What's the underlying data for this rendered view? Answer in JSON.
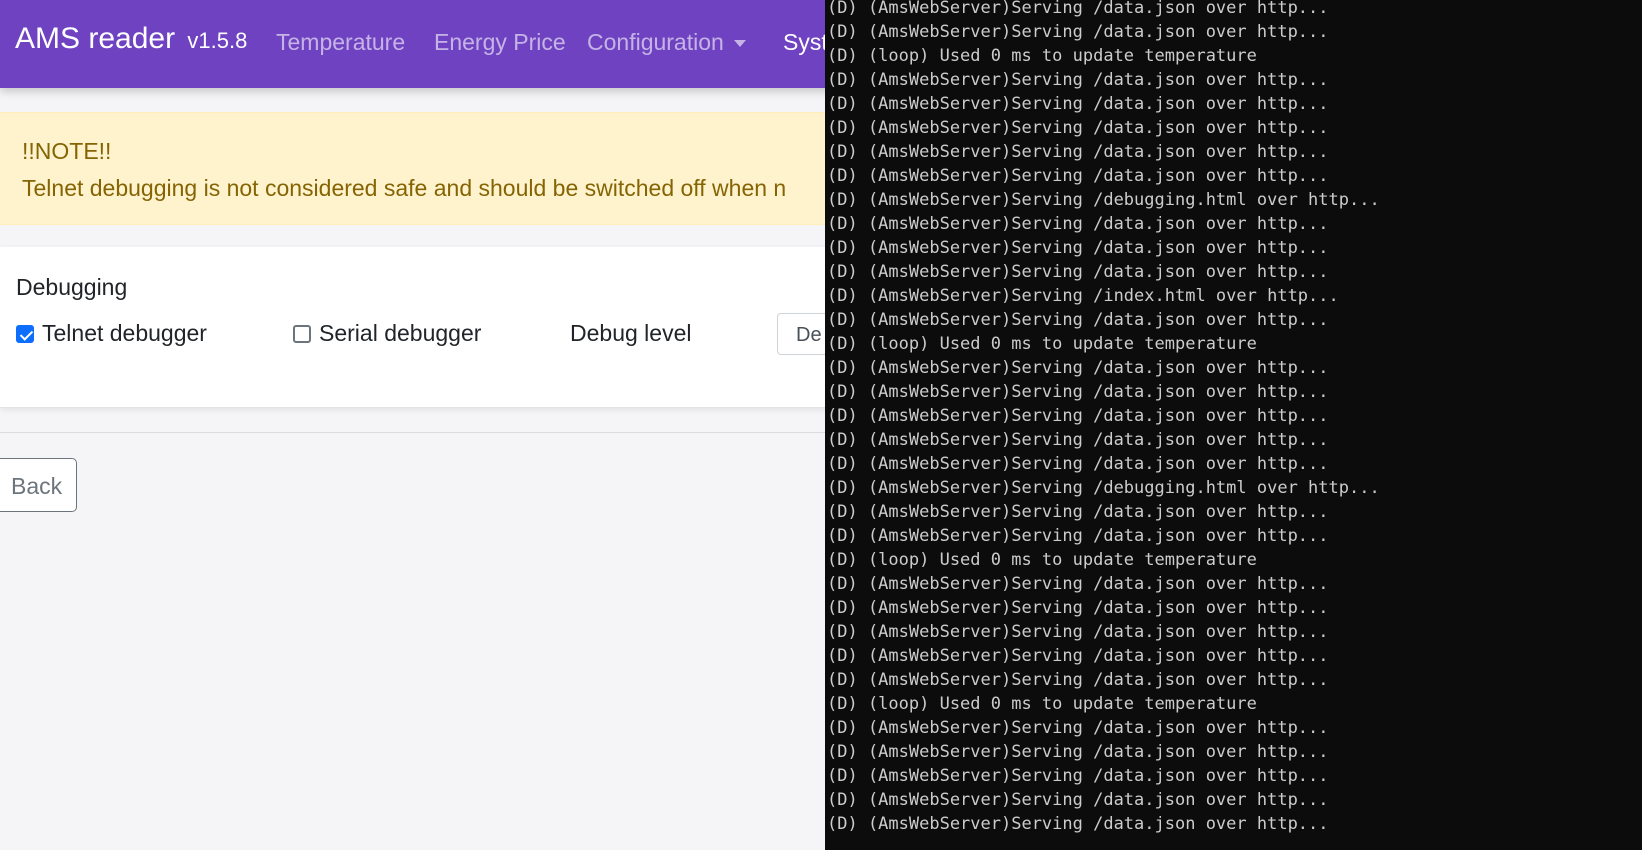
{
  "navbar": {
    "brand": "AMS reader",
    "version": "v1.5.8",
    "links": [
      "Temperature",
      "Energy Price",
      "Configuration",
      "Syst"
    ]
  },
  "alert": {
    "title": "!!NOTE!!",
    "message": "Telnet debugging is not considered safe and should be switched off when n"
  },
  "debugging": {
    "title": "Debugging",
    "telnet_label": "Telnet debugger",
    "telnet_checked": true,
    "serial_label": "Serial debugger",
    "serial_checked": false,
    "level_label": "Debug level",
    "level_value": "De"
  },
  "back_label": "Back",
  "colors": {
    "navbar": "#6f42c1",
    "alert_bg": "#fff3cd",
    "alert_text": "#856404",
    "checkbox_accent": "#0d6efd",
    "terminal_bg": "#0c0c0c",
    "terminal_text": "#cccccc"
  },
  "terminal": {
    "lines": [
      "(D) (AmsWebServer)Serving /data.json over http...",
      "(D) (AmsWebServer)Serving /data.json over http...",
      "(D) (loop) Used 0 ms to update temperature",
      "(D) (AmsWebServer)Serving /data.json over http...",
      "(D) (AmsWebServer)Serving /data.json over http...",
      "(D) (AmsWebServer)Serving /data.json over http...",
      "(D) (AmsWebServer)Serving /data.json over http...",
      "(D) (AmsWebServer)Serving /data.json over http...",
      "(D) (AmsWebServer)Serving /debugging.html over http...",
      "(D) (AmsWebServer)Serving /data.json over http...",
      "(D) (AmsWebServer)Serving /data.json over http...",
      "(D) (AmsWebServer)Serving /data.json over http...",
      "(D) (AmsWebServer)Serving /index.html over http...",
      "(D) (AmsWebServer)Serving /data.json over http...",
      "(D) (loop) Used 0 ms to update temperature",
      "(D) (AmsWebServer)Serving /data.json over http...",
      "(D) (AmsWebServer)Serving /data.json over http...",
      "(D) (AmsWebServer)Serving /data.json over http...",
      "(D) (AmsWebServer)Serving /data.json over http...",
      "(D) (AmsWebServer)Serving /data.json over http...",
      "(D) (AmsWebServer)Serving /debugging.html over http...",
      "(D) (AmsWebServer)Serving /data.json over http...",
      "(D) (AmsWebServer)Serving /data.json over http...",
      "(D) (loop) Used 0 ms to update temperature",
      "(D) (AmsWebServer)Serving /data.json over http...",
      "(D) (AmsWebServer)Serving /data.json over http...",
      "(D) (AmsWebServer)Serving /data.json over http...",
      "(D) (AmsWebServer)Serving /data.json over http...",
      "(D) (AmsWebServer)Serving /data.json over http...",
      "(D) (loop) Used 0 ms to update temperature",
      "(D) (AmsWebServer)Serving /data.json over http...",
      "(D) (AmsWebServer)Serving /data.json over http...",
      "(D) (AmsWebServer)Serving /data.json over http...",
      "(D) (AmsWebServer)Serving /data.json over http...",
      "(D) (AmsWebServer)Serving /data.json over http..."
    ]
  }
}
